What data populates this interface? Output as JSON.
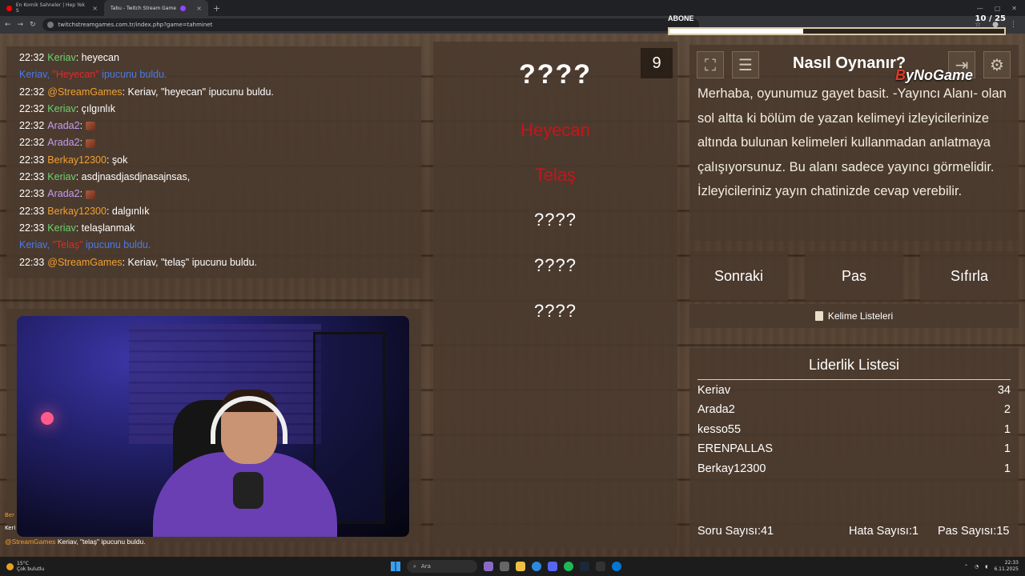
{
  "browser": {
    "tabs": [
      {
        "title": "En Komik Sahneler | Hep Yek S",
        "favicon_color": "#ff0000"
      },
      {
        "title": "Tabu - Twitch Stream Game",
        "favicon_color": "#9146ff"
      }
    ],
    "new_tab": "+",
    "url": "twitchstreamgames.com.tr/index.php?game=tahminet"
  },
  "overlay": {
    "sub_label": "ABONE",
    "sub_count": "10 / 25",
    "sub_progress": 0.4
  },
  "chat": {
    "lines": [
      {
        "time": "22:32",
        "user": "Keriav",
        "color": "green",
        "text": "heyecan"
      },
      {
        "time": "",
        "user": "Keriav,",
        "color": "sys",
        "highlight": "\"Heyecan\"",
        "text": "ipucunu buldu."
      },
      {
        "time": "22:32",
        "user": "@StreamGames",
        "color": "orange",
        "text": "Keriav, \"heyecan\" ipucunu buldu."
      },
      {
        "time": "22:32",
        "user": "Keriav",
        "color": "green",
        "text": "çılgınlık"
      },
      {
        "time": "22:32",
        "user": "Arada2",
        "color": "purple",
        "text": "",
        "emote": true
      },
      {
        "time": "22:32",
        "user": "Arada2",
        "color": "purple",
        "text": "",
        "emote": true
      },
      {
        "time": "22:33",
        "user": "Berkay12300",
        "color": "orange",
        "text": "şok"
      },
      {
        "time": "22:33",
        "user": "Keriav",
        "color": "green",
        "text": "asdjnasdjasdjnasajnsas,"
      },
      {
        "time": "22:33",
        "user": "Arada2",
        "color": "purple",
        "text": "",
        "emote": true
      },
      {
        "time": "22:33",
        "user": "Berkay12300",
        "color": "orange",
        "text": "dalgınlık"
      },
      {
        "time": "22:33",
        "user": "Keriav",
        "color": "green",
        "text": "telaşlanmak"
      },
      {
        "time": "",
        "user": "Keriav,",
        "color": "sys",
        "highlight": "\"Telaş\"",
        "text": "ipucunu buldu."
      },
      {
        "time": "22:33",
        "user": "@StreamGames",
        "color": "orange",
        "text": "Keriav, \"telaş\" ipucunu buldu."
      }
    ]
  },
  "game": {
    "counter": "9",
    "main_word": "????",
    "found_hints": [
      "Heyecan",
      "Telaş"
    ],
    "hidden_hints": [
      "????",
      "????",
      "????"
    ]
  },
  "howto": {
    "title": "Nasıl Oynanır?",
    "logo_b": "B",
    "logo_rest": "yNoGame",
    "text": "Merhaba, oyunumuz gayet basit. -Yayıncı Alanı- olan sol altta ki bölüm de yazan kelimeyi izleyicilerinize altında bulunan kelimeleri kullanmadan anlatmaya çalışıyorsunuz. Bu alanı sadece yayıncı görmelidir. İzleyicileriniz yayın chatinizde cevap verebilir."
  },
  "buttons": {
    "next": "Sonraki",
    "pass": "Pas",
    "reset": "Sıfırla",
    "word_lists": "Kelime Listeleri"
  },
  "leaderboard": {
    "title": "Liderlik Listesi",
    "rows": [
      {
        "name": "Keriav",
        "score": "34"
      },
      {
        "name": "Arada2",
        "score": "2"
      },
      {
        "name": "kesso55",
        "score": "1"
      },
      {
        "name": "ERENPALLAS",
        "score": "1"
      },
      {
        "name": "Berkay12300",
        "score": "1"
      }
    ],
    "question_count": "Soru Sayısı:41",
    "error_count": "Hata Sayısı:1",
    "pass_count": "Pas Sayısı:15"
  },
  "alerts": {
    "small_top": "Ber",
    "small_mid": "Keri",
    "bottom_user": "@StreamGames",
    "bottom_text": "Keriav, \"telaş\" ipucunu buldu."
  },
  "taskbar": {
    "temp": "15°C",
    "weather": "Çok bulutlu",
    "search": "Ara",
    "time": "22:33",
    "date": "6.11.2025"
  }
}
